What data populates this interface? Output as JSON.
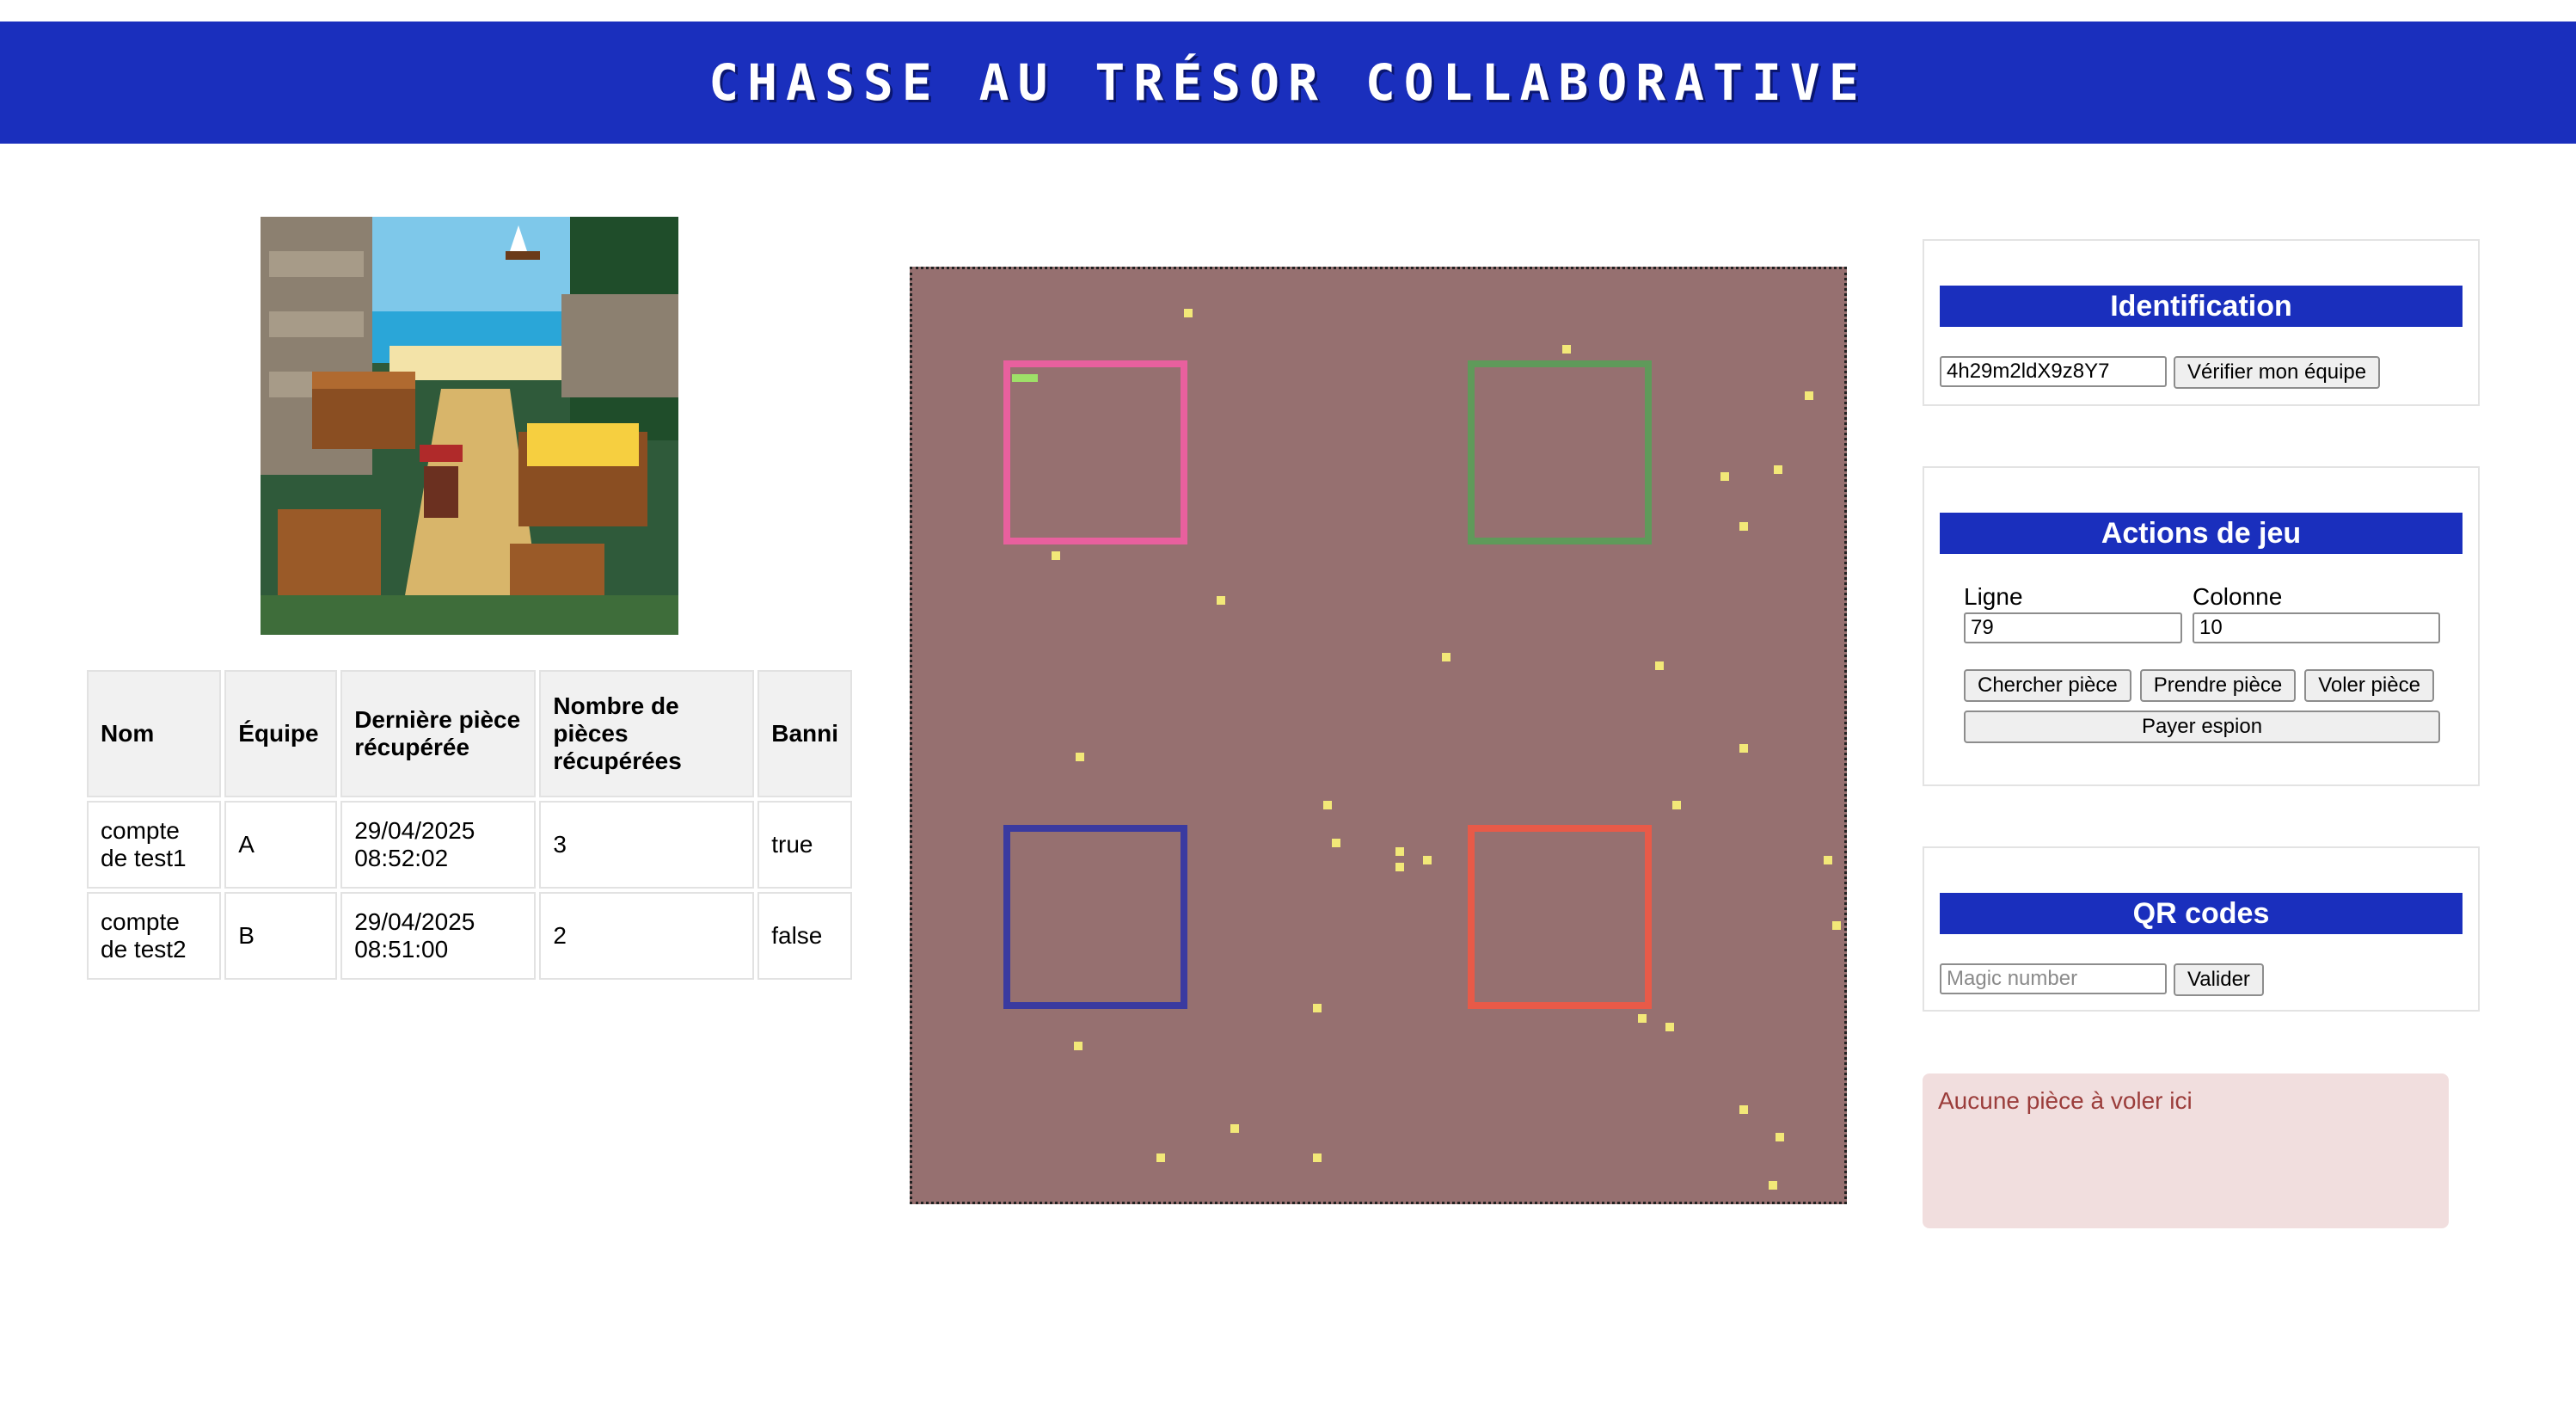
{
  "header": {
    "title": "Chasse au trésor collaborative"
  },
  "players_table": {
    "columns": [
      "Nom",
      "Équipe",
      "Dernière pièce récupérée",
      "Nombre de pièces récupérées",
      "Banni"
    ],
    "rows": [
      [
        "compte de test1",
        "A",
        "29/04/2025 08:52:02",
        "3",
        "true"
      ],
      [
        "compte de test2",
        "B",
        "29/04/2025 08:51:00",
        "2",
        "false"
      ]
    ]
  },
  "board": {
    "background": "#967070",
    "team_zones": [
      {
        "color": "#e8609e"
      },
      {
        "color": "#5f9a5a"
      },
      {
        "color": "#3a3aa0"
      },
      {
        "color": "#e85a48"
      }
    ],
    "coin_color": "#f2e878",
    "player_marker_color": "#9ee068"
  },
  "identification": {
    "title": "Identification",
    "token_value": "4h29m2ldX9z8Y7",
    "verify_button": "Vérifier mon équipe"
  },
  "game_actions": {
    "title": "Actions de jeu",
    "row_label": "Ligne",
    "row_value": "79",
    "col_label": "Colonne",
    "col_value": "10",
    "search_button": "Chercher pièce",
    "take_button": "Prendre pièce",
    "steal_button": "Voler pièce",
    "spy_button": "Payer espion"
  },
  "qr_codes": {
    "title": "QR codes",
    "magic_placeholder": "Magic number",
    "validate_button": "Valider"
  },
  "alert": {
    "message": "Aucune pièce à voler ici",
    "background": "#f1dede",
    "text_color": "#9b3d3b"
  }
}
